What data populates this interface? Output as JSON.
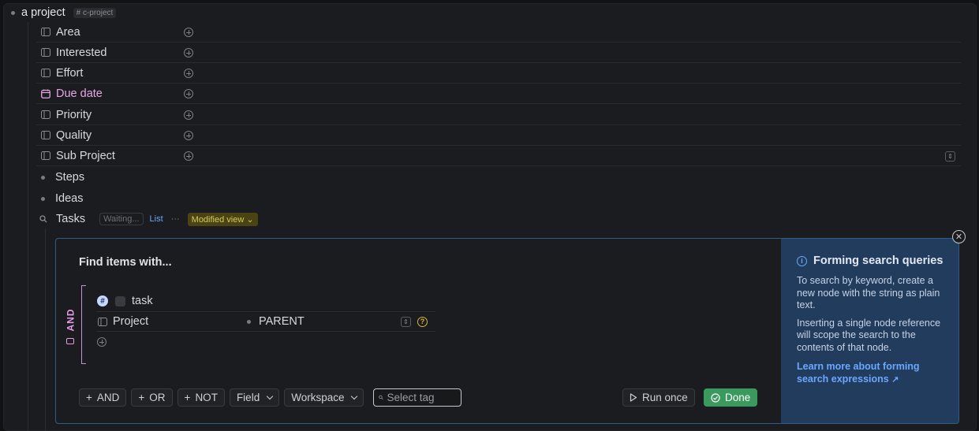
{
  "root": {
    "title": "a project",
    "tag": "# c-project"
  },
  "fields": [
    {
      "label": "Area",
      "icon": "field-icon"
    },
    {
      "label": "Interested",
      "icon": "field-icon"
    },
    {
      "label": "Effort",
      "icon": "field-icon"
    },
    {
      "label": "Due date",
      "icon": "calendar-icon"
    },
    {
      "label": "Priority",
      "icon": "field-icon"
    },
    {
      "label": "Quality",
      "icon": "field-icon"
    },
    {
      "label": "Sub Project",
      "icon": "field-icon"
    }
  ],
  "nodes": [
    {
      "label": "Steps"
    },
    {
      "label": "Ideas"
    }
  ],
  "tasks": {
    "label": "Tasks",
    "waiting": "Waiting...",
    "list_link": "List",
    "more": "···",
    "modified_view": "Modified view"
  },
  "query": {
    "title": "Find items with...",
    "operator": "AND",
    "tag_label": "task",
    "tag_badge": "#",
    "field_label": "Project",
    "field_value": "PARENT",
    "buttons": {
      "and": "AND",
      "or": "OR",
      "not": "NOT",
      "field": "Field",
      "workspace": "Workspace"
    },
    "tag_placeholder": "Select tag",
    "run_once": "Run once",
    "done": "Done"
  },
  "hint": {
    "title": "Forming search queries",
    "p1": "To search by keyword, create a new node with the string as plain text.",
    "p2": "Inserting a single node reference will scope the search to the contents of that node.",
    "link": "Learn more about forming search expressions"
  },
  "colors": {
    "accent": "#6aa7ff",
    "due_date": "#e6a6e6",
    "and_operator": "#e59be9",
    "done": "#3a9a5e",
    "hint_bg": "#223c5e"
  }
}
